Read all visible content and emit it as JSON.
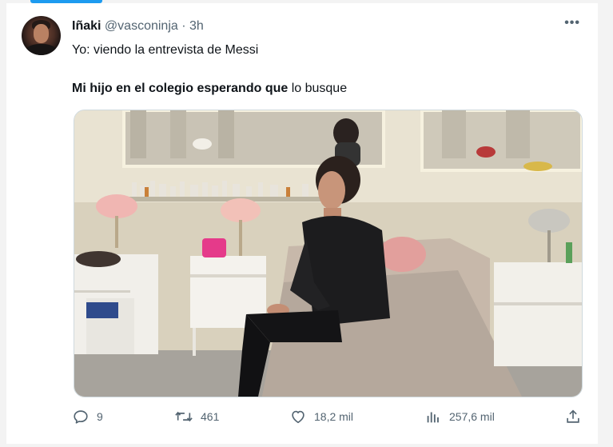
{
  "tweet": {
    "author_name": "Iñaki",
    "author_handle": "@vasconinja",
    "separator": "·",
    "time": "3h",
    "more_label": "•••",
    "line1": "Yo: viendo la entrevista de Messi",
    "line2_bold": "Mi hijo en el colegio esperando que",
    "line2_rest": " lo busque"
  },
  "actions": {
    "replies": "9",
    "retweets": "461",
    "likes": "18,2 mil",
    "views": "257,6 mil"
  },
  "icons": {
    "reply": "reply-icon",
    "retweet": "retweet-icon",
    "like": "heart-icon",
    "views": "views-icon",
    "share": "share-icon"
  },
  "colors": {
    "accent": "#1d9bf0",
    "text_primary": "#0f1419",
    "text_secondary": "#536471"
  }
}
